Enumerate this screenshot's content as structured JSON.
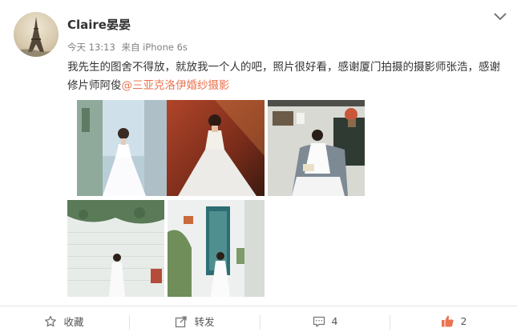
{
  "user": {
    "name": "Claire晏晏"
  },
  "meta": {
    "time": "今天 13:13",
    "source": "来自 iPhone 6s"
  },
  "post": {
    "text": "我先生的图舍不得放，就放我一个人的吧，照片很好看，感谢厦门拍摄的摄影师张浩，感谢修片师阿俊",
    "mention": "@三亚克洛伊婚纱摄影"
  },
  "photos": [
    {
      "subject": "bride-alley"
    },
    {
      "subject": "bride-brick-wall"
    },
    {
      "subject": "bride-reading-chair"
    },
    {
      "subject": "bride-white-wall-plants"
    },
    {
      "subject": "bride-blue-window"
    }
  ],
  "actions": {
    "favorite": {
      "label": "收藏",
      "icon": "star-icon"
    },
    "repost": {
      "label": "转发",
      "icon": "share-icon"
    },
    "comment": {
      "count": "4",
      "icon": "comment-icon"
    },
    "like": {
      "count": "2",
      "icon": "thumbs-up-icon"
    }
  },
  "colors": {
    "mention": "#eb7350",
    "like": "#eb7350",
    "meta": "#808080"
  }
}
